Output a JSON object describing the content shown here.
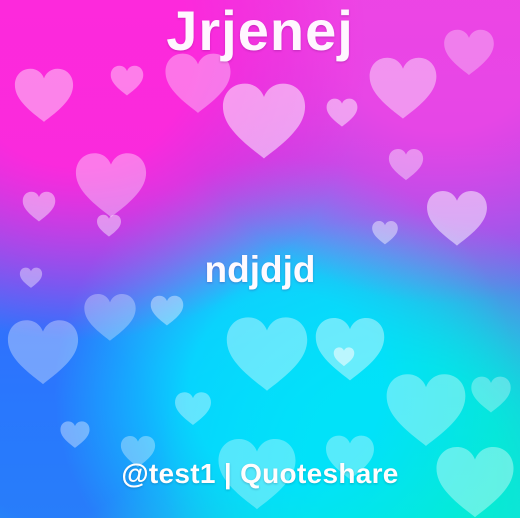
{
  "poster": {
    "title": "Jrjenej",
    "quote": "ndjdjd",
    "footer": "@test1 | Quoteshare"
  },
  "icons": {
    "heart": "heart-icon"
  },
  "colors": {
    "text": "#ffffff",
    "pink": "#ff3ddc",
    "purple": "#9a4ce8",
    "blue": "#4f7cf1",
    "cyan": "#29d8e5"
  }
}
